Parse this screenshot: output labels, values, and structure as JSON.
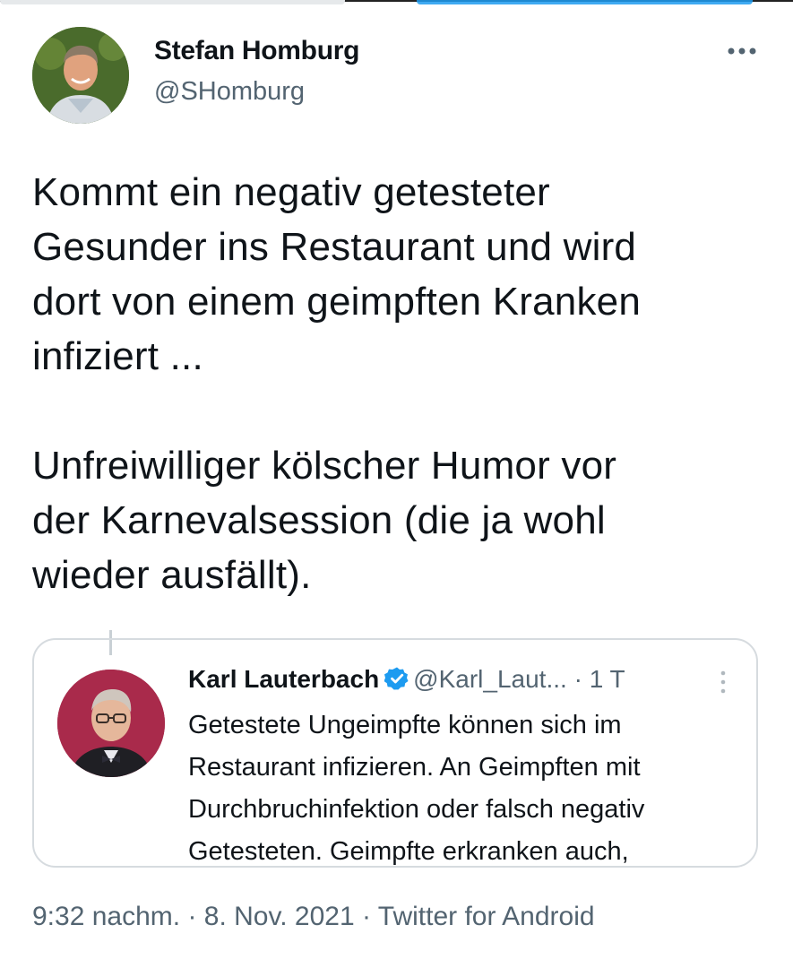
{
  "author": {
    "name": "Stefan Homburg",
    "handle": "@SHomburg",
    "avatar_icon": "profile-photo"
  },
  "tweet": {
    "text": "Kommt ein negativ getesteter\nGesunder ins Restaurant und wird\ndort von einem geimpften Kranken\ninfiziert ...\n\nUnfreiwilliger kölscher Humor vor\nder Karnevalsession (die ja wohl\nwieder ausfällt).",
    "more_icon": "more-horizontal-icon"
  },
  "quote": {
    "name": "Karl Lauterbach",
    "verified_icon": "verified-badge-icon",
    "handle": "@Karl_Laut...",
    "separator": " · ",
    "time": "1 T",
    "text": "Getestete Ungeimpfte können sich im\nRestaurant infizieren. An Geimpften mit\nDurchbruchinfektion oder falsch negativ\nGetesteten. Geimpfte erkranken auch,",
    "more_icon": "more-vertical-icon"
  },
  "meta": {
    "time": "9:32 nachm.",
    "sep1": " · ",
    "date": "8. Nov. 2021",
    "sep2": " · ",
    "source": "Twitter for Android"
  },
  "colors": {
    "accent": "#1d9bf0",
    "secondary_text": "#536471",
    "primary_text": "#0f1419",
    "border": "#d6dbdf"
  }
}
